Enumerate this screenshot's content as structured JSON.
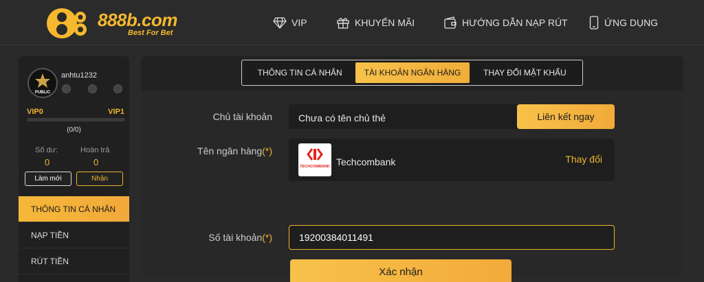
{
  "header": {
    "logo_text": "888b.com",
    "logo_sub": "Best For Bet",
    "nav": [
      {
        "label": "VIP",
        "icon": "diamond-icon"
      },
      {
        "label": "KHUYẾN MÃI",
        "icon": "gift-icon"
      },
      {
        "label": "HƯỚNG DẪN NẠP RÚT",
        "icon": "wallet-icon"
      },
      {
        "label": "ỨNG DỤNG",
        "icon": "phone-icon"
      }
    ]
  },
  "sidebar": {
    "avatar_label": "PUBLIC",
    "username": "anhtu1232",
    "vip_current": "VIP0",
    "vip_next": "VIP1",
    "vip_progress": 0,
    "vip_count": "(0/0)",
    "balance_label": "Số dư:",
    "balance_value": "0",
    "refund_label": "Hoàn trả",
    "refund_value": "0",
    "refresh_button": "Làm mới",
    "receive_button": "Nhận",
    "menu": [
      {
        "label": "THÔNG TIN CÁ NHÂN",
        "active": true
      },
      {
        "label": "NẠP TIỀN",
        "active": false
      },
      {
        "label": "RÚT TIỀN",
        "active": false
      }
    ]
  },
  "tabs": [
    {
      "label": "THÔNG TIN CÁ NHÂN",
      "active": false
    },
    {
      "label": "TÀI KHOẢN NGÂN HÀNG",
      "active": true
    },
    {
      "label": "THAY ĐỔI MẬT KHẨU",
      "active": false
    }
  ],
  "form": {
    "holder_label": "Chủ tài khoản",
    "holder_value": "Chưa có tên chủ thẻ",
    "link_button": "Liên kết ngay",
    "bank_label": "Tên ngân hàng",
    "bank_name": "Techcombank",
    "bank_logo_text": "TECHCOMBANK",
    "change_link": "Thay đổi",
    "account_label": "Số tài khoản",
    "account_value": "19200384011491",
    "required_mark": "(*)",
    "confirm_button": "Xác nhận"
  },
  "colors": {
    "accent": "#f0b530",
    "background": "#2a2a2a",
    "panel": "#222222",
    "techcombank_red": "#e0251b"
  }
}
